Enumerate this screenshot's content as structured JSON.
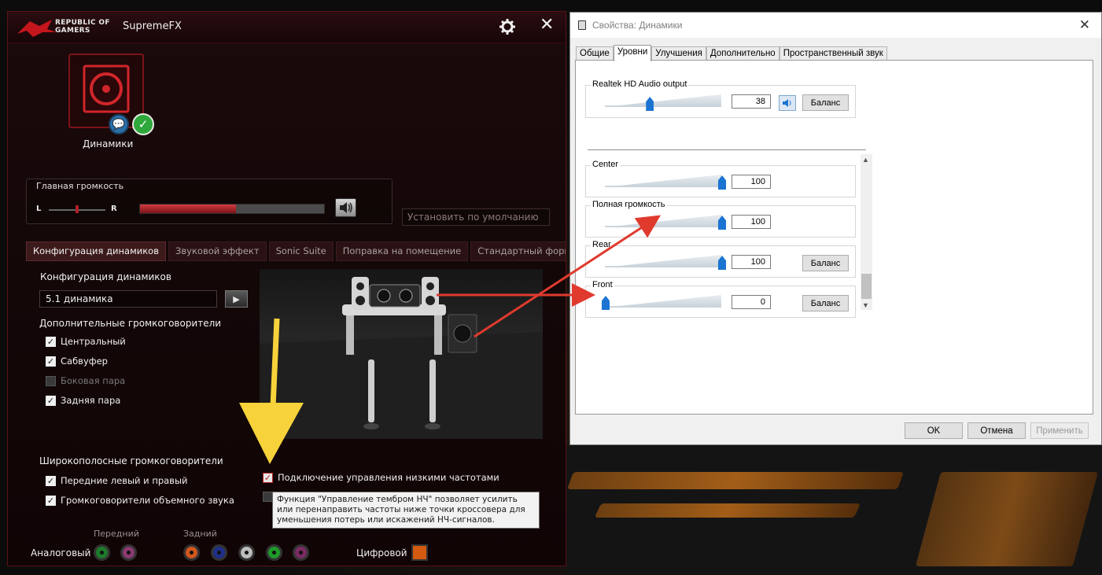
{
  "colors": {
    "rog_red": "#b02026",
    "win_accent": "#1b74d2",
    "annotation_red": "#e03a2e",
    "annotation_yellow": "#f7d23a"
  },
  "rog": {
    "brand_line1": "REPUBLIC OF",
    "brand_line2": "GAMERS",
    "title": "SupremeFX",
    "device_label": "Динамики",
    "main_volume": {
      "title": "Главная громкость",
      "left": "L",
      "right": "R",
      "level": 0.52
    },
    "default_button": "Установить по умолчанию",
    "tabs": [
      {
        "label": "Конфигурация динамиков",
        "active": true
      },
      {
        "label": "Звуковой эффект",
        "active": false
      },
      {
        "label": "Sonic Suite",
        "active": false
      },
      {
        "label": "Поправка на помещение",
        "active": false
      },
      {
        "label": "Стандартный формат",
        "active": false
      }
    ],
    "config_title": "Конфигурация динамиков",
    "config_value": "5.1 динамика",
    "extra_title": "Дополнительные громкоговорители",
    "extra": [
      {
        "label": "Центральный",
        "checked": true,
        "disabled": false
      },
      {
        "label": "Сабвуфер",
        "checked": true,
        "disabled": false
      },
      {
        "label": "Боковая пара",
        "checked": false,
        "disabled": true
      },
      {
        "label": "Задняя пара",
        "checked": true,
        "disabled": false
      }
    ],
    "broadband_title": "Широкополосные громкоговорители",
    "broadband": [
      {
        "label": "Передние левый и правый",
        "checked": true
      },
      {
        "label": "Громкоговорители объемного звука",
        "checked": true
      }
    ],
    "bass_management": "Подключение управления низкими частотами",
    "tooltip": "Функция \"Управление тембром НЧ\" позволяет усилить или перенаправить частоты ниже точки кроссовера для уменьшения потерь или искажений НЧ-сигналов.",
    "footer": {
      "front": "Передний",
      "rear": "Задний",
      "analog": "Аналоговый",
      "digital": "Цифровой"
    }
  },
  "win": {
    "title": "Свойства: Динамики",
    "tabs": [
      {
        "label": "Общие",
        "active": false
      },
      {
        "label": "Уровни",
        "active": true
      },
      {
        "label": "Улучшения",
        "active": false
      },
      {
        "label": "Дополнительно",
        "active": false
      },
      {
        "label": "Пространственный звук",
        "active": false
      }
    ],
    "output": {
      "label": "Realtek HD Audio output",
      "value": "38",
      "balance": "Баланс"
    },
    "levels": [
      {
        "label": "Center",
        "value": "100",
        "has_balance": false
      },
      {
        "label": "Полная громкость",
        "value": "100",
        "has_balance": false
      },
      {
        "label": "Rear",
        "value": "100",
        "has_balance": true,
        "balance": "Баланс"
      },
      {
        "label": "Front",
        "value": "0",
        "has_balance": true,
        "balance": "Баланс"
      }
    ],
    "buttons": {
      "ok": "OK",
      "cancel": "Отмена",
      "apply": "Применить"
    }
  }
}
